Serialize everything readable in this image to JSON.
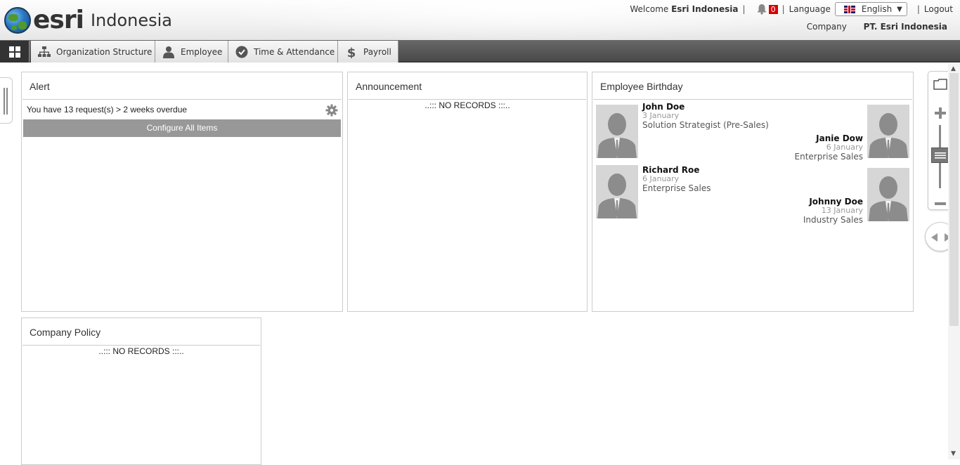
{
  "header": {
    "logo_text": "esri",
    "logo_subtext": "Indonesia",
    "welcome_label": "Welcome",
    "user_name": "Esri Indonesia",
    "notification_count": "0",
    "language_label": "Language",
    "language_value": "English",
    "logout_label": "Logout",
    "company_label": "Company",
    "company_value": "PT. Esri Indonesia"
  },
  "nav": {
    "items": [
      {
        "label": "Organization Structure",
        "icon": "org-chart-icon"
      },
      {
        "label": "Employee",
        "icon": "person-icon"
      },
      {
        "label": "Time & Attendance",
        "icon": "clock-icon"
      },
      {
        "label": "Payroll",
        "icon": "dollar-icon"
      }
    ]
  },
  "panels": {
    "alert": {
      "title": "Alert",
      "message": "You have 13 request(s) > 2 weeks overdue",
      "configure_label": "Configure All Items"
    },
    "announcement": {
      "title": "Announcement",
      "empty_text": "..::: NO RECORDS :::.."
    },
    "birthday": {
      "title": "Employee Birthday",
      "people": [
        {
          "name": "John Doe",
          "date": "3 January",
          "role": "Solution Strategist (Pre-Sales)"
        },
        {
          "name": "Janie Dow",
          "date": "6 January",
          "role": "Enterprise Sales"
        },
        {
          "name": "Richard Roe",
          "date": "6 January",
          "role": "Enterprise Sales"
        },
        {
          "name": "Johnny Doe",
          "date": "13 January",
          "role": "Industry Sales"
        }
      ]
    },
    "policy": {
      "title": "Company Policy",
      "empty_text": "..::: NO RECORDS :::.."
    }
  },
  "colors": {
    "nav_bg": "#4a4a4a",
    "badge": "#d90000",
    "configure_button": "#989898"
  }
}
